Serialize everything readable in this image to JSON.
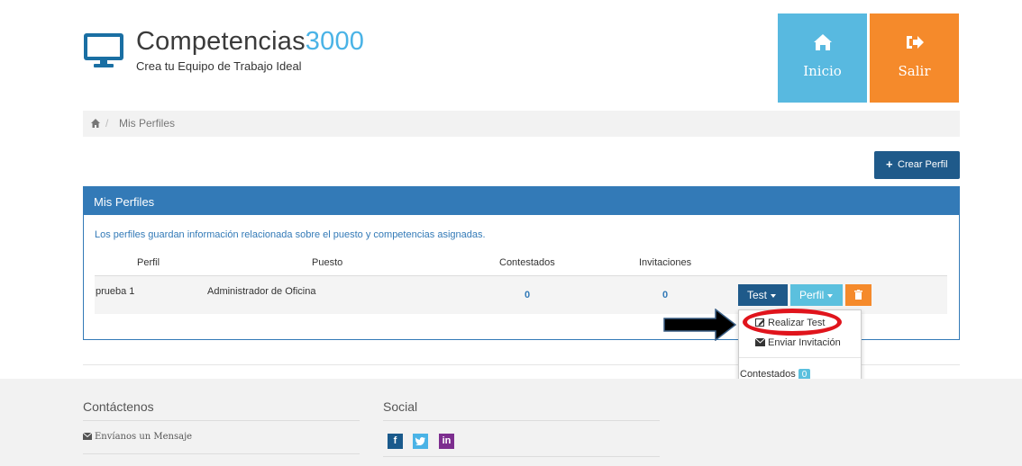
{
  "brand": {
    "title_main": "Competencias",
    "title_accent": "3000",
    "subtitle": "Crea tu Equipo de Trabajo Ideal",
    "icon": "monitor-icon"
  },
  "header_buttons": {
    "inicio": {
      "label": "Inicio",
      "icon": "home-icon",
      "color": "#58b9e0"
    },
    "salir": {
      "label": "Salir",
      "icon": "sign-out-icon",
      "color": "#f58a2b"
    }
  },
  "breadcrumb": {
    "home_icon": "home-icon",
    "separator": "/",
    "current": "Mis Perfiles"
  },
  "actions": {
    "crear_perfil_label": "Crear Perfil",
    "crear_icon": "plus-icon"
  },
  "panel": {
    "title": "Mis Perfiles",
    "description": "Los perfiles guardan información relacionada sobre el puesto y competencias asignadas.",
    "columns": [
      "Perfil",
      "Puesto",
      "Contestados",
      "Invitaciones"
    ],
    "rows": [
      {
        "perfil": "prueba 1",
        "puesto": "Administrador de Oficina",
        "contestados": "0",
        "invitaciones": "0",
        "test_label": "Test",
        "perfil_label": "Perfil",
        "delete_icon": "trash-icon"
      }
    ]
  },
  "dropdown": {
    "items": [
      {
        "label": "Realizar Test",
        "icon": "edit-icon"
      },
      {
        "label": "Enviar Invitación",
        "icon": "envelope-icon"
      }
    ],
    "contestados_label": "Contestados",
    "contestados_count": "0"
  },
  "annotation": {
    "highlight_color": "#e0141c",
    "arrow_color": "#000000"
  },
  "footer": {
    "contact_heading": "Contáctenos",
    "contact_link": "Envíanos un Mensaje",
    "social_heading": "Social",
    "social": [
      {
        "label": "f",
        "icon": "facebook-icon",
        "color": "#1a5a8c"
      },
      {
        "label": "t",
        "icon": "twitter-icon",
        "color": "#4ab3e6"
      },
      {
        "label": "in",
        "icon": "linkedin-icon",
        "color": "#7d2e8f"
      }
    ]
  },
  "colors": {
    "primary": "#337ab7",
    "dark_blue": "#1f5a8a",
    "light_blue": "#5bc0de",
    "orange": "#f58a2b"
  }
}
